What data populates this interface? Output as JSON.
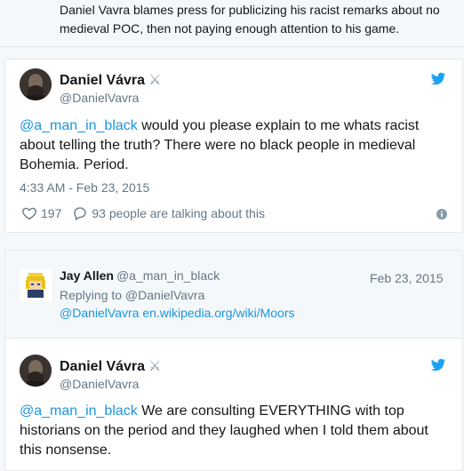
{
  "caption": "Daniel Vavra blames press for publicizing his racist remarks about no medieval POC, then not paying enough attention to his game.",
  "tweet1": {
    "name": "Daniel Vávra",
    "name_icon": "crossed-swords",
    "handle": "@DanielVavra",
    "mention": "@a_man_in_black",
    "text": " would you please explain to me whats racist about telling the truth? There were no black people in medieval Bohemia. Period.",
    "timestamp": "4:33 AM - Feb 23, 2015",
    "likes": "197",
    "talking": "93 people are talking about this"
  },
  "tweet2": {
    "name": "Jay Allen",
    "handle": "@a_man_in_black",
    "date": "Feb 23, 2015",
    "replying_to": "Replying to @DanielVavra",
    "mention": "@DanielVavra",
    "link": "en.wikipedia.org/wiki/Moors"
  },
  "tweet3": {
    "name": "Daniel Vávra",
    "name_icon": "crossed-swords",
    "handle": "@DanielVavra",
    "mention": "@a_man_in_black",
    "text": " We are consulting EVERYTHING with top historians on the period and they laughed when I told them about this nonsense."
  },
  "colors": {
    "link_blue": "#1b95e0",
    "twitter_blue": "#1da1f2",
    "muted_gray": "#657786",
    "border": "#e1e8ed"
  }
}
